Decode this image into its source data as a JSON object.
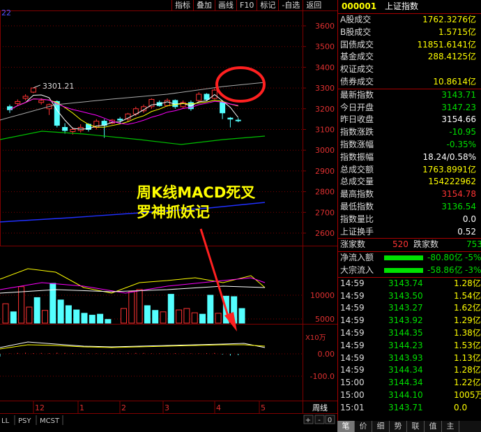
{
  "top_menu": [
    "指标",
    "叠加",
    "画线",
    "F10",
    "标记",
    "-自选",
    "返回"
  ],
  "left_label": "22",
  "chart_data": {
    "type": "candlestick",
    "price_ticks": [
      "3600",
      "3500",
      "3400",
      "3300",
      "3200",
      "3100",
      "3000",
      "2900",
      "2800",
      "2700",
      "2600"
    ],
    "peak_label": "3301.21",
    "volume_ticks": [
      "10000",
      "5000"
    ],
    "volume_unit": "X10万",
    "macd_ticks": [
      "0.00",
      "-100.0"
    ],
    "month_labels": [
      "12",
      "1",
      "2",
      "3",
      "4",
      "5"
    ],
    "period_label": "周线",
    "candles": [
      {
        "o": 3210,
        "c": 3195,
        "h": 3220,
        "l": 3180
      },
      {
        "o": 3225,
        "c": 3235,
        "h": 3245,
        "l": 3215
      },
      {
        "o": 3250,
        "c": 3260,
        "h": 3270,
        "l": 3240
      },
      {
        "o": 3280,
        "c": 3300,
        "h": 3301,
        "l": 3275
      },
      {
        "o": 3230,
        "c": 3240,
        "h": 3250,
        "l": 3220
      },
      {
        "o": 3200,
        "c": 3220,
        "h": 3225,
        "l": 3170
      },
      {
        "o": 3235,
        "c": 3120,
        "h": 3240,
        "l": 3110
      },
      {
        "o": 3110,
        "c": 3095,
        "h": 3130,
        "l": 3080
      },
      {
        "o": 3090,
        "c": 3100,
        "h": 3110,
        "l": 3075
      },
      {
        "o": 3095,
        "c": 3110,
        "h": 3125,
        "l": 3085
      },
      {
        "o": 3125,
        "c": 3100,
        "h": 3130,
        "l": 3090
      },
      {
        "o": 3110,
        "c": 3140,
        "h": 3150,
        "l": 3100
      },
      {
        "o": 3140,
        "c": 3120,
        "h": 3150,
        "l": 3060
      },
      {
        "o": 3130,
        "c": 3145,
        "h": 3150,
        "l": 3125
      },
      {
        "o": 3150,
        "c": 3145,
        "h": 3160,
        "l": 3130
      },
      {
        "o": 3150,
        "c": 3175,
        "h": 3180,
        "l": 3140
      },
      {
        "o": 3175,
        "c": 3200,
        "h": 3210,
        "l": 3165
      },
      {
        "o": 3190,
        "c": 3210,
        "h": 3220,
        "l": 3180
      },
      {
        "o": 3210,
        "c": 3245,
        "h": 3250,
        "l": 3200
      },
      {
        "o": 3230,
        "c": 3215,
        "h": 3240,
        "l": 3210
      },
      {
        "o": 3215,
        "c": 3240,
        "h": 3250,
        "l": 3210
      },
      {
        "o": 3240,
        "c": 3210,
        "h": 3245,
        "l": 3200
      },
      {
        "o": 3210,
        "c": 3230,
        "h": 3240,
        "l": 3200
      },
      {
        "o": 3230,
        "c": 3200,
        "h": 3240,
        "l": 3190
      },
      {
        "o": 3240,
        "c": 3270,
        "h": 3280,
        "l": 3235
      },
      {
        "o": 3270,
        "c": 3245,
        "h": 3275,
        "l": 3240
      },
      {
        "o": 3250,
        "c": 3290,
        "h": 3298,
        "l": 3245
      },
      {
        "o": 3230,
        "c": 3180,
        "h": 3235,
        "l": 3150
      },
      {
        "o": 3155,
        "c": 3150,
        "h": 3160,
        "l": 3110
      },
      {
        "o": 3145,
        "c": 3143,
        "h": 3155,
        "l": 3135
      }
    ],
    "volumes": [
      8200,
      6500,
      11800,
      7500,
      9500,
      6800,
      12500,
      9000,
      7800,
      6900,
      6200,
      5800,
      6000,
      4900,
      1800,
      7200,
      10800,
      11200,
      7800,
      6800,
      6500,
      10200,
      6900,
      7200,
      6300,
      6000,
      10000,
      6200,
      9800,
      9700,
      7200,
      2500
    ],
    "volume_types": [
      "d",
      "u",
      "d",
      "d",
      "u",
      "d",
      "u",
      "u",
      "u",
      "u",
      "u",
      "u",
      "u",
      "u",
      "u",
      "d",
      "d",
      "d",
      "u",
      "u",
      "d",
      "u",
      "d",
      "d",
      "d",
      "u",
      "u",
      "d",
      "u",
      "u",
      "u",
      "u"
    ],
    "macd_hist": [
      2,
      4,
      5,
      3,
      4,
      3,
      5,
      4,
      3,
      2,
      2,
      2,
      2,
      3,
      2,
      3,
      4,
      4,
      2,
      2,
      2,
      3,
      2,
      2,
      2,
      3,
      4,
      -3,
      -8,
      -6,
      -12
    ]
  },
  "annotation": {
    "line1": "周K线MACD死叉",
    "line2": "罗神抓妖记"
  },
  "bottom_left_tabs": [
    "LL",
    "PSY",
    "MCST"
  ],
  "bottom_controls": [
    "+",
    "-",
    "0"
  ],
  "stock": {
    "code": "000001",
    "name": "上证指数"
  },
  "volume_rows": [
    {
      "label": "A股成交",
      "value": "1762.3276亿"
    },
    {
      "label": "B股成交",
      "value": "1.5715亿"
    },
    {
      "label": "国债成交",
      "value": "11851.6141亿"
    },
    {
      "label": "基金成交",
      "value": "288.4125亿"
    },
    {
      "label": "权证成交",
      "value": ""
    },
    {
      "label": "债券成交",
      "value": "10.8614亿"
    }
  ],
  "quote_rows": [
    {
      "label": "最新指数",
      "value": "3143.71",
      "color": "#00e000"
    },
    {
      "label": "今日开盘",
      "value": "3147.23",
      "color": "#00e000"
    },
    {
      "label": "昨日收盘",
      "value": "3154.66",
      "color": "#ffffff"
    },
    {
      "label": "指数涨跌",
      "value": "-10.95",
      "color": "#00e000"
    },
    {
      "label": "指数涨幅",
      "value": "-0.35%",
      "color": "#00e000"
    },
    {
      "label": "指数振幅",
      "value": "18.24/0.58%",
      "color": "#ffffff"
    },
    {
      "label": "总成交额",
      "value": "1763.8991亿",
      "color": "#ffff00"
    },
    {
      "label": "总成交量",
      "value": "154222962",
      "color": "#ffff00"
    },
    {
      "label": "最高指数",
      "value": "3154.78",
      "color": "#ff3333"
    },
    {
      "label": "最低指数",
      "value": "3136.54",
      "color": "#00e000"
    },
    {
      "label": "指数量比",
      "value": "0.0",
      "color": "#ffffff"
    },
    {
      "label": "上证换手",
      "value": "0.52",
      "color": "#ffffff"
    }
  ],
  "breadth": {
    "up_label": "涨家数",
    "up_value": "520",
    "down_label": "跌家数",
    "down_value": "753"
  },
  "flows": [
    {
      "label": "净流入额",
      "value": "-80.80亿",
      "pct": "-5%"
    },
    {
      "label": "大宗流入",
      "value": "-58.86亿",
      "pct": "-3%"
    }
  ],
  "ticks": [
    {
      "t": "14:59",
      "p": "3143.74",
      "v": "1.28亿"
    },
    {
      "t": "14:59",
      "p": "3143.50",
      "v": "1.54亿"
    },
    {
      "t": "14:59",
      "p": "3143.27",
      "v": "1.62亿"
    },
    {
      "t": "14:59",
      "p": "3143.92",
      "v": "1.29亿"
    },
    {
      "t": "14:59",
      "p": "3144.35",
      "v": "1.38亿"
    },
    {
      "t": "14:59",
      "p": "3144.23",
      "v": "1.53亿"
    },
    {
      "t": "14:59",
      "p": "3143.93",
      "v": "1.13亿"
    },
    {
      "t": "14:59",
      "p": "3144.34",
      "v": "1.28亿"
    },
    {
      "t": "15:00",
      "p": "3144.34",
      "v": "1.22亿"
    },
    {
      "t": "15:00",
      "p": "3144.10",
      "v": "1005万"
    },
    {
      "t": "15:01",
      "p": "3143.71",
      "v": "0.0"
    }
  ],
  "bottom_tabs": [
    "笔",
    "价",
    "细",
    "势",
    "联",
    "值",
    "主"
  ],
  "colors": {
    "up": "#ff3232",
    "down": "#54ffff",
    "grid": "#800000",
    "accent": "#ffff00"
  }
}
